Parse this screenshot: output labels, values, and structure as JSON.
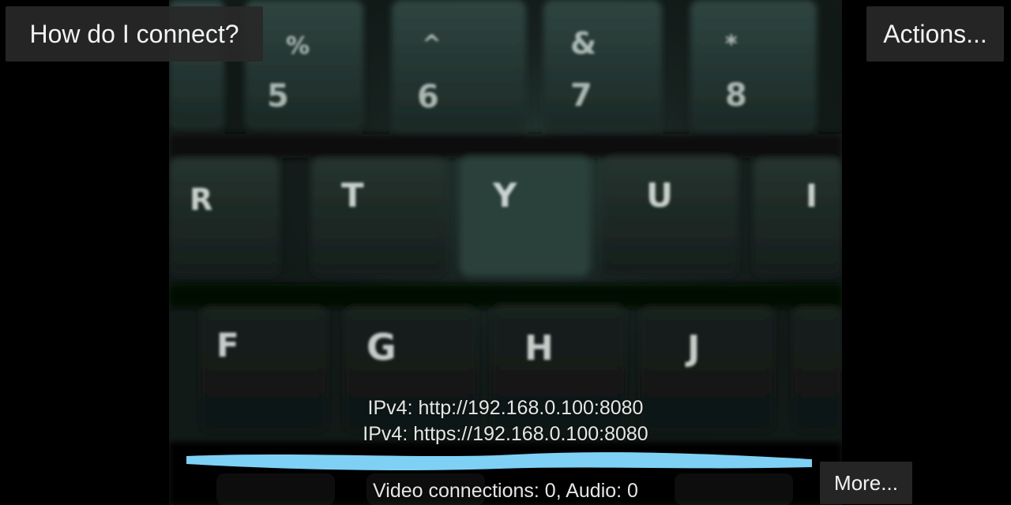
{
  "header": {
    "connect_label": "How do I connect?",
    "actions_label": "Actions..."
  },
  "preview": {
    "number_row": [
      {
        "top": "%",
        "bottom": "5"
      },
      {
        "top": "^",
        "bottom": "6"
      },
      {
        "top": "&",
        "bottom": "7"
      },
      {
        "top": "*",
        "bottom": "8"
      }
    ],
    "letter_row_1": [
      "R",
      "T",
      "Y",
      "U",
      "I"
    ],
    "letter_row_2": [
      "F",
      "G",
      "H",
      "J"
    ]
  },
  "info": {
    "ipv4_http": "IPv4: http://192.168.0.100:8080",
    "ipv4_https": "IPv4: https://192.168.0.100:8080",
    "connections": "Video connections: 0, Audio: 0"
  },
  "footer": {
    "more_label": "More..."
  },
  "colors": {
    "button_bg": "#282828",
    "text": "#f2f2f2",
    "redaction": "#7fd0f5"
  }
}
